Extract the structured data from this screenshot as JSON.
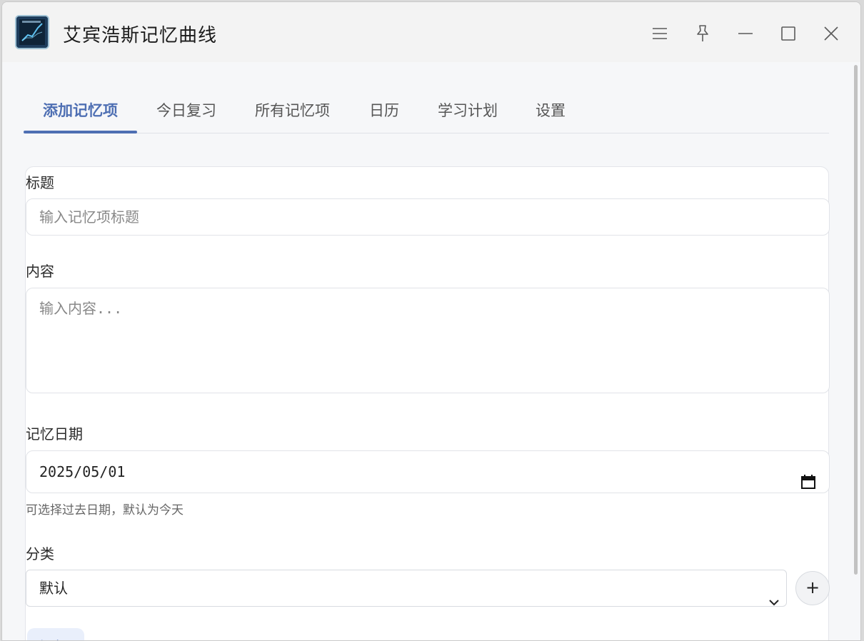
{
  "window": {
    "title": "艾宾浩斯记忆曲线",
    "controls": [
      "menu-icon",
      "pin-icon",
      "minimize-icon",
      "maximize-icon",
      "close-icon"
    ]
  },
  "tabs": [
    {
      "label": "添加记忆项",
      "active": true
    },
    {
      "label": "今日复习",
      "active": false
    },
    {
      "label": "所有记忆项",
      "active": false
    },
    {
      "label": "日历",
      "active": false
    },
    {
      "label": "学习计划",
      "active": false
    },
    {
      "label": "设置",
      "active": false
    }
  ],
  "form": {
    "title_label": "标题",
    "title_placeholder": "输入记忆项标题",
    "content_label": "内容",
    "content_placeholder": "输入内容...",
    "date_label": "记忆日期",
    "date_value": "2025/05/01",
    "date_hint": "可选择过去日期，默认为今天",
    "category_label": "分类",
    "category_value": "默认",
    "add_category_label": "+",
    "submit_label": "添加"
  },
  "colors": {
    "accent": "#4e6fb3",
    "background": "#f6f7f9",
    "titlebar": "#f3f3f3"
  }
}
